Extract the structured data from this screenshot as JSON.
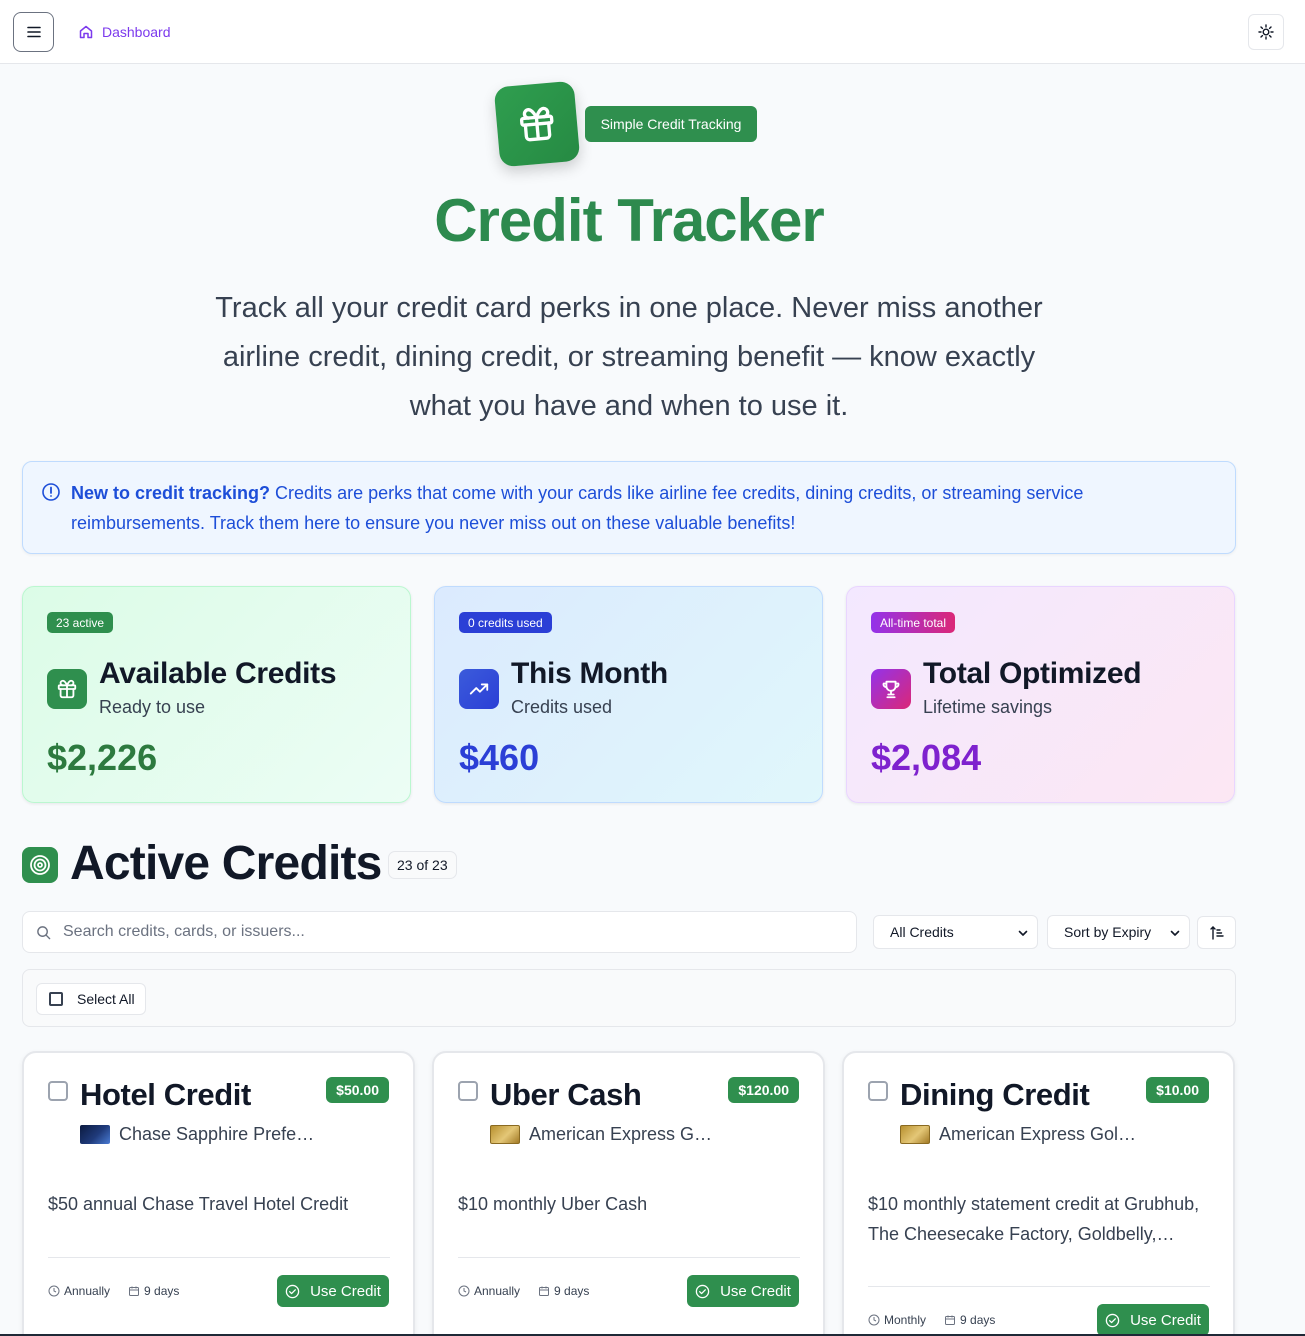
{
  "topbar": {
    "menu_icon": "hamburger-icon",
    "breadcrumb_label": "Dashboard",
    "breadcrumb_icon": "home-icon",
    "theme_icon": "sun-icon"
  },
  "hero": {
    "logo_icon": "gift-icon",
    "badge": "Simple Credit Tracking",
    "title": "Credit Tracker",
    "subtitle": "Track all your credit card perks in one place. Never miss another airline credit, dining credit, or streaming benefit — know exactly what you have and when to use it."
  },
  "info": {
    "icon": "info-icon",
    "lead": "New to credit tracking?",
    "body": " Credits are perks that come with your cards like airline fee credits, dining credits, or streaming service reimbursements. Track them here to ensure you never miss out on these valuable benefits!"
  },
  "stats": [
    {
      "pill": "23 active",
      "title": "Available Credits",
      "subtitle": "Ready to use",
      "value": "$2,226",
      "icon": "gift-icon",
      "color": "#2f8f4e"
    },
    {
      "pill": "0 credits used",
      "title": "This Month",
      "subtitle": "Credits used",
      "value": "$460",
      "icon": "trending-up-icon",
      "color": "#2b3fd6"
    },
    {
      "pill": "All-time total",
      "title": "Total Optimized",
      "subtitle": "Lifetime savings",
      "value": "$2,084",
      "icon": "trophy-icon",
      "color": "#8b1fd8"
    }
  ],
  "section": {
    "icon": "target-icon",
    "title": "Active Credits",
    "count": "23 of 23"
  },
  "filters": {
    "search_placeholder": "Search credits, cards, or issuers...",
    "search_value": "",
    "type_filter": "All Credits",
    "sort": "Sort by Expiry",
    "sort_direction_icon": "sort-ascending-icon"
  },
  "selection": {
    "select_all_label": "Select All"
  },
  "credits": [
    {
      "title": "Hotel Credit",
      "amount": "$50.00",
      "card": "Chase Sapphire Prefe…",
      "card_art": "chase",
      "description": "$50 annual Chase Travel Hotel Credit",
      "frequency": "Annually",
      "expires": "9 days",
      "button": "Use Credit"
    },
    {
      "title": "Uber Cash",
      "amount": "$120.00",
      "card": "American Express G…",
      "card_art": "amex",
      "description": "$10 monthly Uber Cash",
      "frequency": "Annually",
      "expires": "9 days",
      "button": "Use Credit"
    },
    {
      "title": "Dining Credit",
      "amount": "$10.00",
      "card": "American Express Gol…",
      "card_art": "amex",
      "description": "$10 monthly statement credit at Grubhub, The Cheesecake Factory, Goldbelly,…",
      "frequency": "Monthly",
      "expires": "9 days",
      "button": "Use Credit"
    }
  ]
}
